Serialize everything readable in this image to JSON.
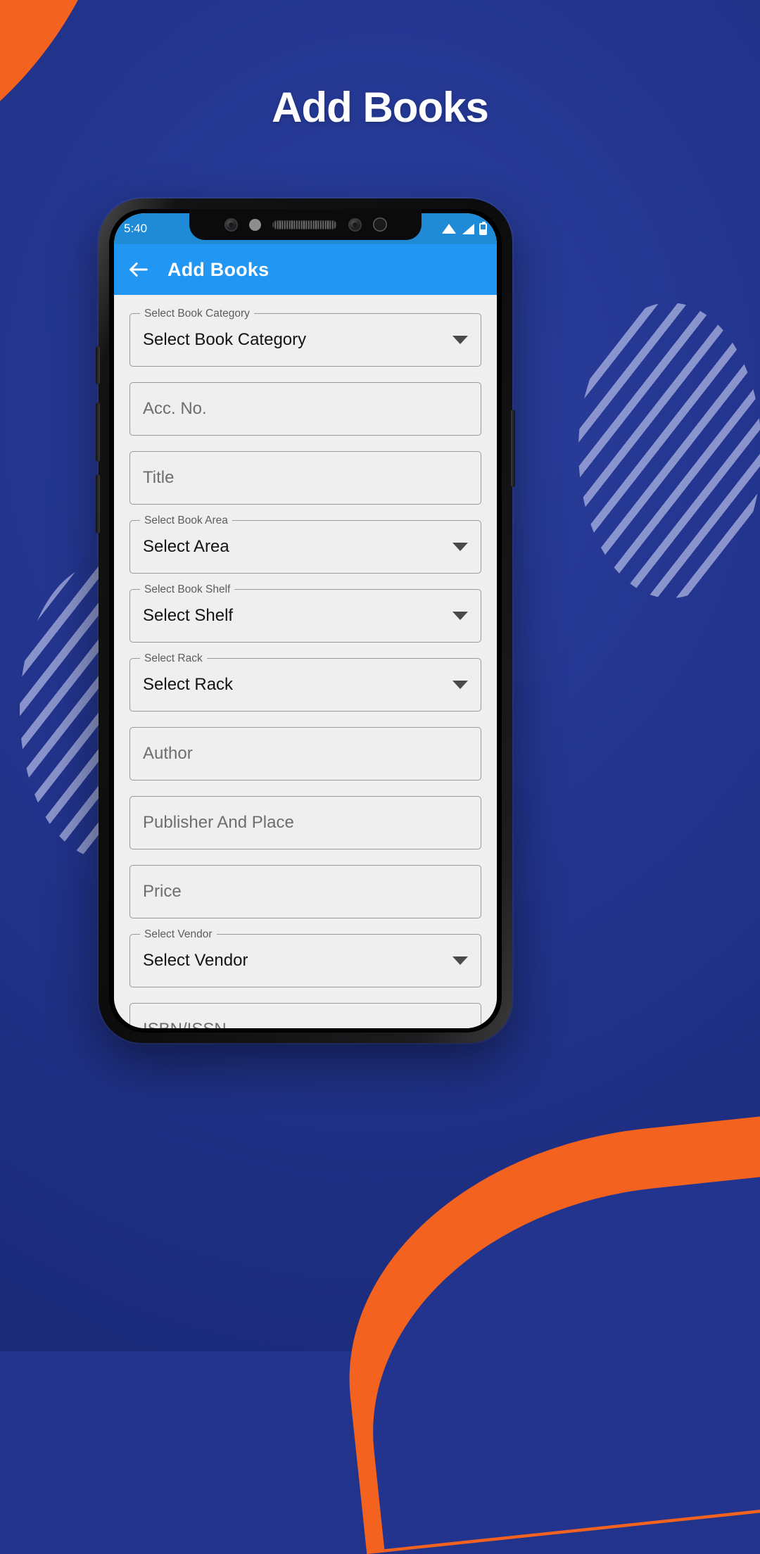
{
  "promo": {
    "title": "Add Books",
    "background_color": "#22348d",
    "accent_color": "#f4621f"
  },
  "phone": {
    "statusbar": {
      "time": "5:40",
      "icons": [
        "wifi-icon",
        "signal-icon",
        "battery-icon"
      ],
      "background_color": "#1f8bd6"
    },
    "appbar": {
      "back_icon": "back-arrow-icon",
      "title": "Add Books",
      "background_color": "#2196f3"
    },
    "form": {
      "fields": [
        {
          "type": "dropdown",
          "label": "Select Book Category",
          "value": "Select Book Category",
          "name": "book-category"
        },
        {
          "type": "text",
          "label": "",
          "placeholder": "Acc. No.",
          "name": "acc-no"
        },
        {
          "type": "text",
          "label": "",
          "placeholder": "Title",
          "name": "title"
        },
        {
          "type": "dropdown",
          "label": "Select Book Area",
          "value": "Select Area",
          "name": "book-area"
        },
        {
          "type": "dropdown",
          "label": "Select Book Shelf",
          "value": "Select Shelf",
          "name": "book-shelf"
        },
        {
          "type": "dropdown",
          "label": "Select Rack",
          "value": "Select Rack",
          "name": "rack"
        },
        {
          "type": "text",
          "label": "",
          "placeholder": "Author",
          "name": "author"
        },
        {
          "type": "text",
          "label": "",
          "placeholder": "Publisher And Place",
          "name": "publisher-and-place"
        },
        {
          "type": "text",
          "label": "",
          "placeholder": "Price",
          "name": "price"
        },
        {
          "type": "dropdown",
          "label": "Select Vendor",
          "value": "Select Vendor",
          "name": "vendor"
        },
        {
          "type": "text",
          "label": "",
          "placeholder": "ISBN/ISSN",
          "name": "isbn-issn"
        }
      ]
    }
  }
}
